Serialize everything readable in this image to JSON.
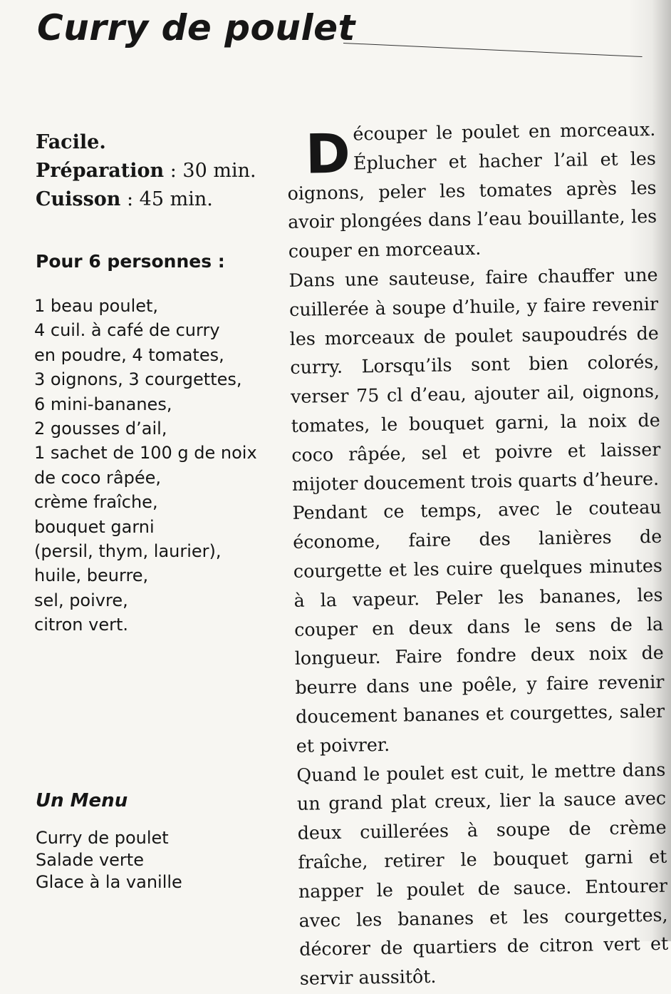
{
  "recipe": {
    "title": "Curry de poulet",
    "difficulty": "Facile.",
    "prep_label": "Préparation",
    "prep_value": " : 30 min.",
    "cook_label": "Cuisson",
    "cook_value": " : 45 min.",
    "serves": "Pour 6 personnes :",
    "ingredients": [
      "1 beau poulet,",
      "4 cuil. à café de curry",
      "en poudre, 4 tomates,",
      "3 oignons, 3 courgettes,",
      "6 mini-bananes,",
      "2 gousses d’ail,",
      "1 sachet de 100 g de noix",
      "de coco râpée,",
      "crème fraîche,",
      "bouquet garni",
      "(persil, thym, laurier),",
      "huile, beurre,",
      "sel, poivre,",
      "citron vert."
    ],
    "dropcap": "D",
    "first_paragraph": "écouper le poulet en morceaux. Éplucher et hacher l’ail et les oignons, peler les tomates après les avoir plongées dans l’eau bouillante, les couper en morceaux.",
    "paragraphs": [
      "Dans une sauteuse, faire chauffer une cuillerée à soupe d’huile, y faire revenir les morceaux de poulet saupoudrés de curry. Lorsqu’ils sont bien colorés, verser 75 cl d’eau, ajouter ail, oignons, tomates, le bouquet garni, la noix de coco râpée, sel et poivre et laisser mijoter doucement trois quarts d’heure.",
      "Pendant ce temps, avec le couteau économe, faire des lanières de courgette et les cuire quelques minutes à la vapeur. Peler les bananes, les couper en deux dans le sens de la longueur. Faire fondre deux noix de beurre dans une poêle, y faire revenir doucement bananes et courgettes, saler et poivrer.",
      "Quand le poulet est cuit, le mettre dans un grand plat creux, lier la sauce avec deux cuillerées à soupe de crème fraîche, retirer le bouquet garni et napper le poulet de sauce. Entourer avec les bananes et les courgettes, décorer de quartiers de citron vert et servir aussitôt."
    ]
  },
  "menu": {
    "title": "Un Menu",
    "items": [
      "Curry de poulet",
      "Salade verte",
      "Glace à la vanille"
    ]
  }
}
